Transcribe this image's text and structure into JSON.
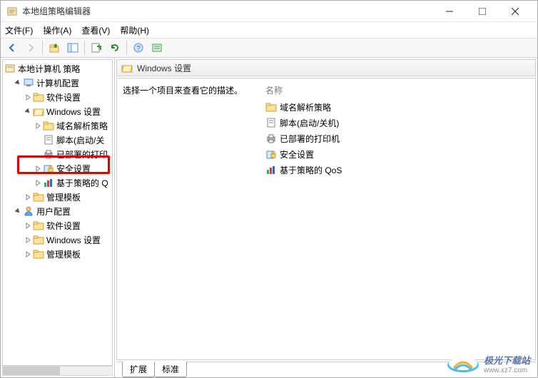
{
  "window": {
    "title": "本地组策略编辑器"
  },
  "menu": {
    "file": "文件(F)",
    "action": "操作(A)",
    "view": "查看(V)",
    "help": "帮助(H)"
  },
  "tree": {
    "root": "本地计算机 策略",
    "computer_config": "计算机配置",
    "software_settings": "软件设置",
    "windows_settings": "Windows 设置",
    "name_res_policy": "域名解析策略",
    "scripts": "脚本(启动/关",
    "deployed_printers": "已部署的打印",
    "security_settings": "安全设置",
    "policy_based_qos": "基于策略的 Q",
    "admin_templates": "管理模板",
    "user_config": "用户配置",
    "software_settings2": "软件设置",
    "windows_settings2": "Windows 设置",
    "admin_templates2": "管理模板"
  },
  "content": {
    "header": "Windows 设置",
    "desc": "选择一个项目来查看它的描述。",
    "col_name": "名称",
    "items": {
      "name_res": "域名解析策略",
      "scripts": "脚本(启动/关机)",
      "printers": "已部署的打印机",
      "security": "安全设置",
      "qos": "基于策略的 QoS"
    }
  },
  "tabs": {
    "extended": "扩展",
    "standard": "标准"
  },
  "watermark": {
    "name": "极光下载站",
    "url": "www.xz7.com"
  }
}
